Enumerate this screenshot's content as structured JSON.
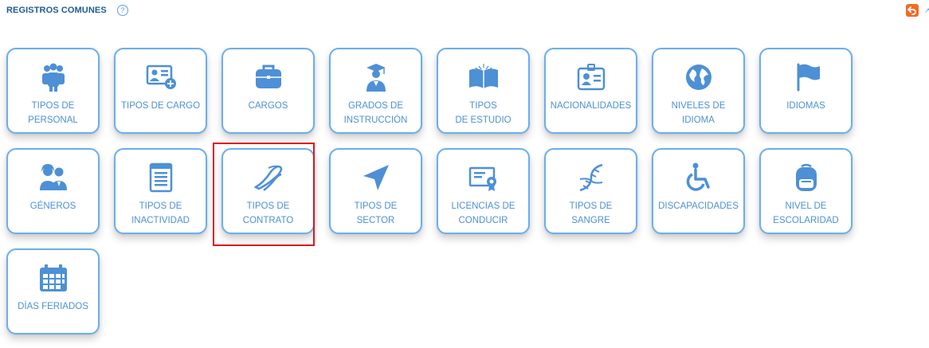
{
  "header": {
    "title": "REGISTROS COMUNES",
    "help_label": "?"
  },
  "colors": {
    "accent": "#4d90d6",
    "tile_border": "#6aaef0",
    "back_button": "#f36b24",
    "highlight": "#e0141c"
  },
  "tiles": [
    {
      "label": "TIPOS DE\nPERSONAL",
      "icon": "users-group-icon"
    },
    {
      "label": "TIPOS DE CARGO",
      "icon": "id-card-add-icon"
    },
    {
      "label": "CARGOS",
      "icon": "briefcase-icon"
    },
    {
      "label": "GRADOS DE\nINSTRUCCIÓN",
      "icon": "graduate-icon"
    },
    {
      "label": "TIPOS\nDE ESTUDIO",
      "icon": "open-book-icon"
    },
    {
      "label": "NACIONALIDADES",
      "icon": "id-badge-icon"
    },
    {
      "label": "NIVELES DE\nIDIOMA",
      "icon": "globe-icon"
    },
    {
      "label": "IDIOMAS",
      "icon": "flag-icon"
    },
    {
      "label": "GÉNEROS",
      "icon": "couple-icon"
    },
    {
      "label": "TIPOS DE\nINACTIVIDAD",
      "icon": "document-list-icon"
    },
    {
      "label": "TIPOS DE\nCONTRATO",
      "icon": "handshake-icon"
    },
    {
      "label": "TIPOS DE\nSECTOR",
      "icon": "location-arrow-icon"
    },
    {
      "label": "LICENCIAS DE\nCONDUCIR",
      "icon": "certificate-icon"
    },
    {
      "label": "TIPOS DE\nSANGRE",
      "icon": "dna-icon"
    },
    {
      "label": "DISCAPACIDADES",
      "icon": "wheelchair-icon"
    },
    {
      "label": "NIVEL DE\nESCOLARIDAD",
      "icon": "backpack-icon"
    },
    {
      "label": "DÍAS FERIADOS",
      "icon": "calendar-icon"
    }
  ]
}
